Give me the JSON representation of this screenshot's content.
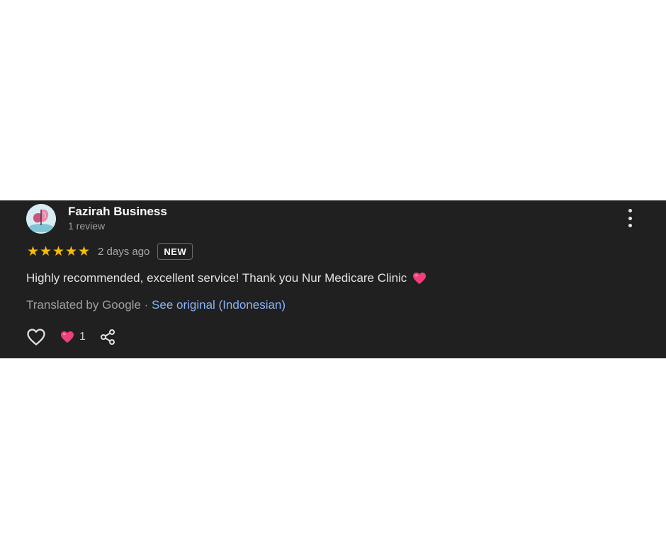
{
  "review": {
    "reviewer_name": "Fazirah Business",
    "reviewer_meta": "1 review",
    "rating": 5,
    "stars": [
      "★",
      "★",
      "★",
      "★",
      "★"
    ],
    "date": "2 days ago",
    "badge": "NEW",
    "text": "Highly recommended, excellent service! Thank you Nur Medicare Clinic",
    "text_emoji": "heart-emoji",
    "translated_by": "Translated by Google",
    "separator": " · ",
    "see_original": "See original (Indonesian)",
    "reaction_count": "1"
  },
  "icons": {
    "avatar": "butterfly-avatar",
    "more": "more-vertical-icon",
    "like": "heart-outline-icon",
    "reaction": "heart-reaction-icon",
    "share": "share-icon"
  },
  "colors": {
    "card_background": "#202020",
    "star": "#fbbc04",
    "link": "#8ab4f8",
    "heart": "#f0407a",
    "muted_text": "#a0a0a0",
    "primary_text": "#e3e3e3"
  }
}
